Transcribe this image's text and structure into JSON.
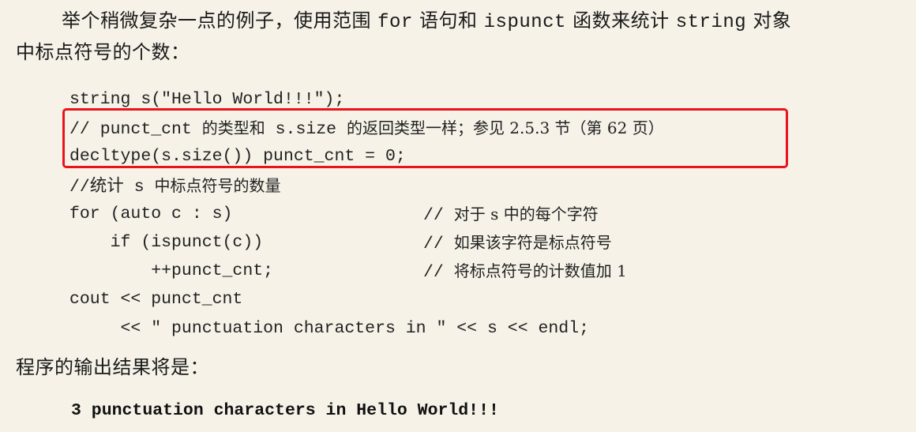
{
  "intro": {
    "line1_a": "举个稍微复杂一点的例子，使用范围",
    "line1_kw1": "for",
    "line1_b": "语句和",
    "line1_kw2": "ispunct",
    "line1_c": "函数来统计",
    "line1_kw3": "string",
    "line1_d": "对象",
    "line2": "中标点符号的个数："
  },
  "code": {
    "line1": "string s(\"Hello World!!!\");",
    "line2_a": "// punct_cnt ",
    "line2_b": "的类型和",
    "line2_c": " s.size ",
    "line2_d": "的返回类型一样；参见 2.5.3 节（第 62 页）",
    "line3": "decltype(s.size()) punct_cnt = 0;",
    "line4_a": "//统计 s ",
    "line4_b": "中标点符号的数量",
    "line5_code": "for (auto c : s)",
    "line5_cmt_a": "// ",
    "line5_cmt_b": "对于 s 中的每个字符",
    "line6_code": "    if (ispunct(c))",
    "line6_cmt_a": "// ",
    "line6_cmt_b": "如果该字符是标点符号",
    "line7_code": "        ++punct_cnt;",
    "line7_cmt_a": "// ",
    "line7_cmt_b": "将标点符号的计数值加 1",
    "line8": "cout << punct_cnt",
    "line9": "     << \" punctuation characters in \" << s << endl;"
  },
  "output_label": "程序的输出结果将是：",
  "output_text": "3 punctuation characters in Hello World!!!",
  "colors": {
    "page_background": "#f6f2e8",
    "highlight_border": "#e8141c"
  }
}
